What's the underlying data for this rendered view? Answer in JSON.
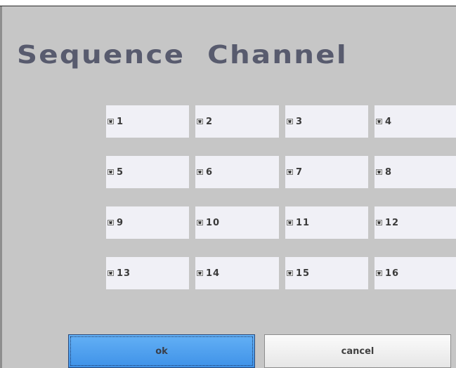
{
  "dialog": {
    "title": "Sequence  Channel"
  },
  "channels": [
    {
      "label": "1",
      "checked": true
    },
    {
      "label": "2",
      "checked": true
    },
    {
      "label": "3",
      "checked": true
    },
    {
      "label": "4",
      "checked": true
    },
    {
      "label": "5",
      "checked": true
    },
    {
      "label": "6",
      "checked": true
    },
    {
      "label": "7",
      "checked": true
    },
    {
      "label": "8",
      "checked": true
    },
    {
      "label": "9",
      "checked": true
    },
    {
      "label": "10",
      "checked": true
    },
    {
      "label": "11",
      "checked": true
    },
    {
      "label": "12",
      "checked": true
    },
    {
      "label": "13",
      "checked": true
    },
    {
      "label": "14",
      "checked": true
    },
    {
      "label": "15",
      "checked": true
    },
    {
      "label": "16",
      "checked": true
    }
  ],
  "buttons": {
    "ok_label": "ok",
    "cancel_label": "cancel"
  },
  "colors": {
    "background": "#c6c6c6",
    "title": "#585b6e",
    "cell": "#f0f0f6",
    "ok_button": "#4a9cf0"
  },
  "icons": {
    "checkbox": "checkbox-checked-icon"
  }
}
